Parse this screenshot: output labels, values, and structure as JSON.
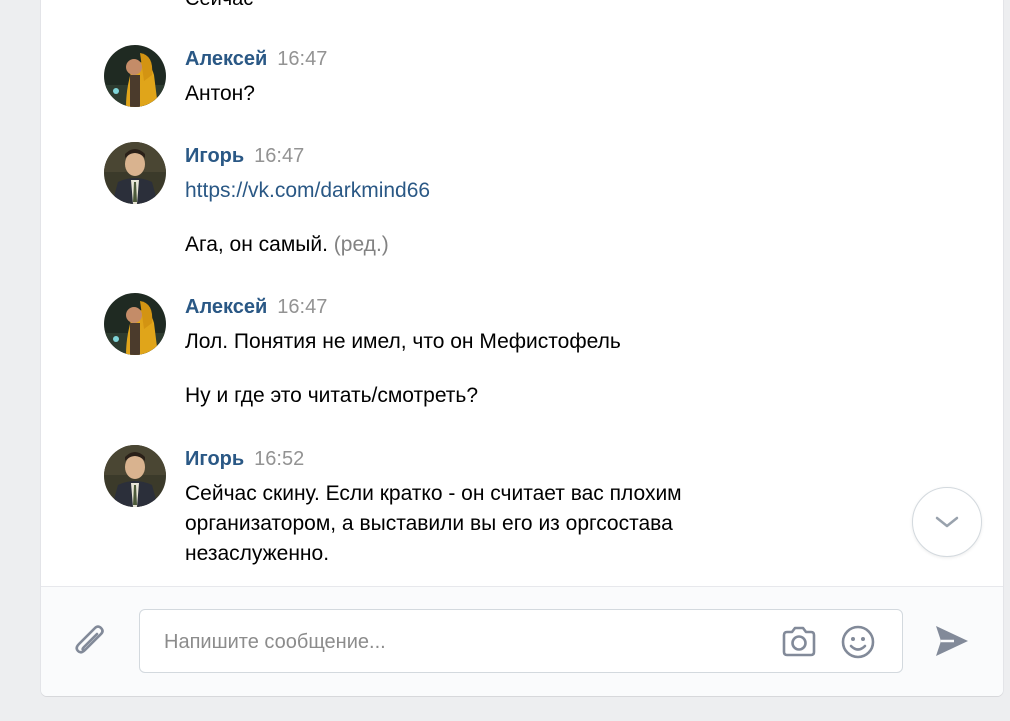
{
  "previous_fragment": "Сейчас",
  "messages": [
    {
      "author": "Алексей",
      "time": "16:47",
      "lines": [
        "Антон?"
      ]
    },
    {
      "author": "Игорь",
      "time": "16:47",
      "link": "https://vk.com/darkmind66",
      "lines": [
        "Ага, он самый."
      ],
      "edited_label": "(ред.)"
    },
    {
      "author": "Алексей",
      "time": "16:47",
      "lines": [
        "Лол. Понятия не имел, что он Мефистофель",
        "Ну и где это читать/смотреть?"
      ]
    },
    {
      "author": "Игорь",
      "time": "16:52",
      "lines": [
        "Сейчас скину. Если кратко - он считает вас плохим",
        "организатором, а выставили вы его из оргсостава",
        "незаслуженно."
      ]
    }
  ],
  "composer": {
    "placeholder": "Напишите сообщение...",
    "attach_icon": "paperclip-icon",
    "camera_icon": "camera-icon",
    "emoji_icon": "smile-icon",
    "send_icon": "send-arrow-icon"
  },
  "colors": {
    "author": "#2a5885",
    "link": "#2a5885",
    "time": "#939393",
    "icon": "#828a99"
  }
}
